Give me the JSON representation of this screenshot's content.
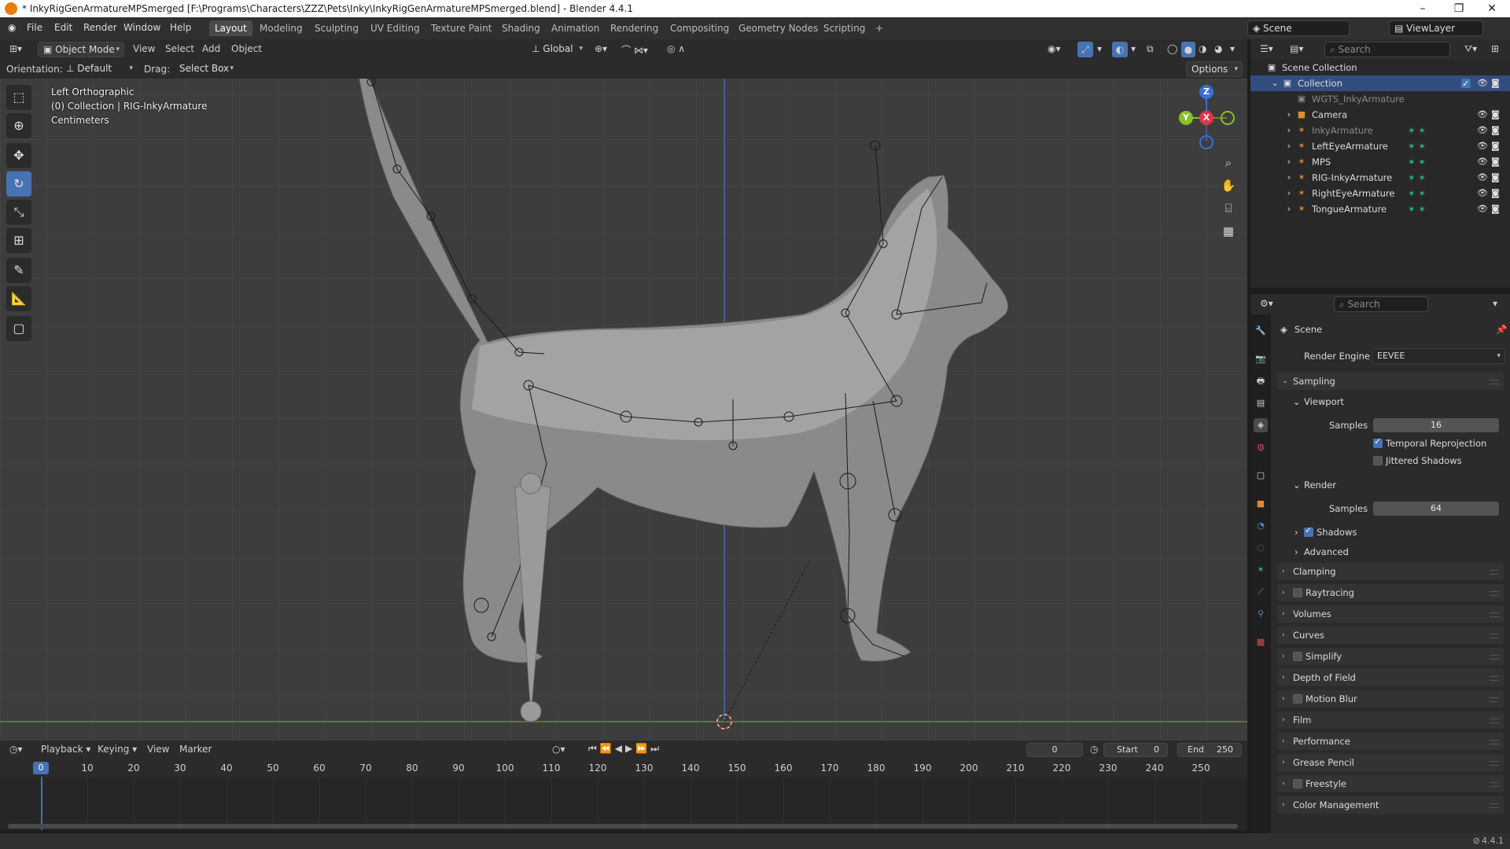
{
  "window": {
    "title": "* InkyRigGenArmatureMPSmerged [F:\\Programs\\Characters\\ZZZ\\Pets\\Inky\\InkyRigGenArmatureMPSmerged.blend] - Blender 4.4.1",
    "controls": [
      "–",
      "❐",
      "✕"
    ]
  },
  "menu": [
    "File",
    "Edit",
    "Render",
    "Window",
    "Help"
  ],
  "workspaces": [
    "Layout",
    "Modeling",
    "Sculpting",
    "UV Editing",
    "Texture Paint",
    "Shading",
    "Animation",
    "Rendering",
    "Compositing",
    "Geometry Nodes",
    "Scripting",
    "+"
  ],
  "scene": {
    "name": "Scene",
    "view_layer": "ViewLayer"
  },
  "viewport_header": {
    "mode": "Object Mode",
    "menus": [
      "View",
      "Select",
      "Add",
      "Object"
    ],
    "transform_orientation": "Global",
    "orientation_label": "Orientation:",
    "orientation_value": "Default",
    "drag_label": "Drag:",
    "drag_value": "Select Box",
    "options": "Options"
  },
  "viewport_overlay": {
    "view_name": "Left Orthographic",
    "collection_info": "(0) Collection | RIG-InkyArmature",
    "units": "Centimeters"
  },
  "gizmo": {
    "z": "Z",
    "y": "Y",
    "x": "X"
  },
  "tools": [
    "select-box",
    "cursor",
    "move",
    "rotate",
    "scale",
    "transform",
    "annotate",
    "measure",
    "add-cube"
  ],
  "outliner": {
    "search_placeholder": "Search",
    "root": "Scene Collection",
    "collection": "Collection",
    "items": [
      {
        "name": "WGTS_InkyArmature",
        "dim": true
      },
      {
        "name": "Camera",
        "dim": false
      },
      {
        "name": "InkyArmature",
        "dim": true
      },
      {
        "name": "LeftEyeArmature",
        "dim": false
      },
      {
        "name": "MPS",
        "dim": false
      },
      {
        "name": "RIG-InkyArmature",
        "dim": false
      },
      {
        "name": "RightEyeArmature",
        "dim": false
      },
      {
        "name": "TongueArmature",
        "dim": false
      }
    ]
  },
  "properties": {
    "search_placeholder": "Search",
    "context": "Scene",
    "render_engine_label": "Render Engine",
    "render_engine": "EEVEE",
    "sampling": "Sampling",
    "viewport": "Viewport",
    "samples_label": "Samples",
    "viewport_samples": "16",
    "temporal_reprojection": "Temporal Reprojection",
    "jittered_shadows": "Jittered Shadows",
    "render": "Render",
    "render_samples": "64",
    "shadows": "Shadows",
    "advanced": "Advanced",
    "panels": [
      "Clamping",
      "Raytracing",
      "Volumes",
      "Curves",
      "Simplify",
      "Depth of Field",
      "Motion Blur",
      "Film",
      "Performance",
      "Grease Pencil",
      "Freestyle",
      "Color Management"
    ]
  },
  "timeline": {
    "menus": [
      "Playback",
      "Keying",
      "View",
      "Marker"
    ],
    "current_frame": "0",
    "start_label": "Start",
    "start": "0",
    "end_label": "End",
    "end": "250",
    "ticks": [
      "0",
      "10",
      "20",
      "30",
      "40",
      "50",
      "60",
      "70",
      "80",
      "90",
      "100",
      "110",
      "120",
      "130",
      "140",
      "150",
      "160",
      "170",
      "180",
      "190",
      "200",
      "210",
      "220",
      "230",
      "240",
      "250"
    ]
  },
  "status": {
    "version": "4.4.1"
  }
}
